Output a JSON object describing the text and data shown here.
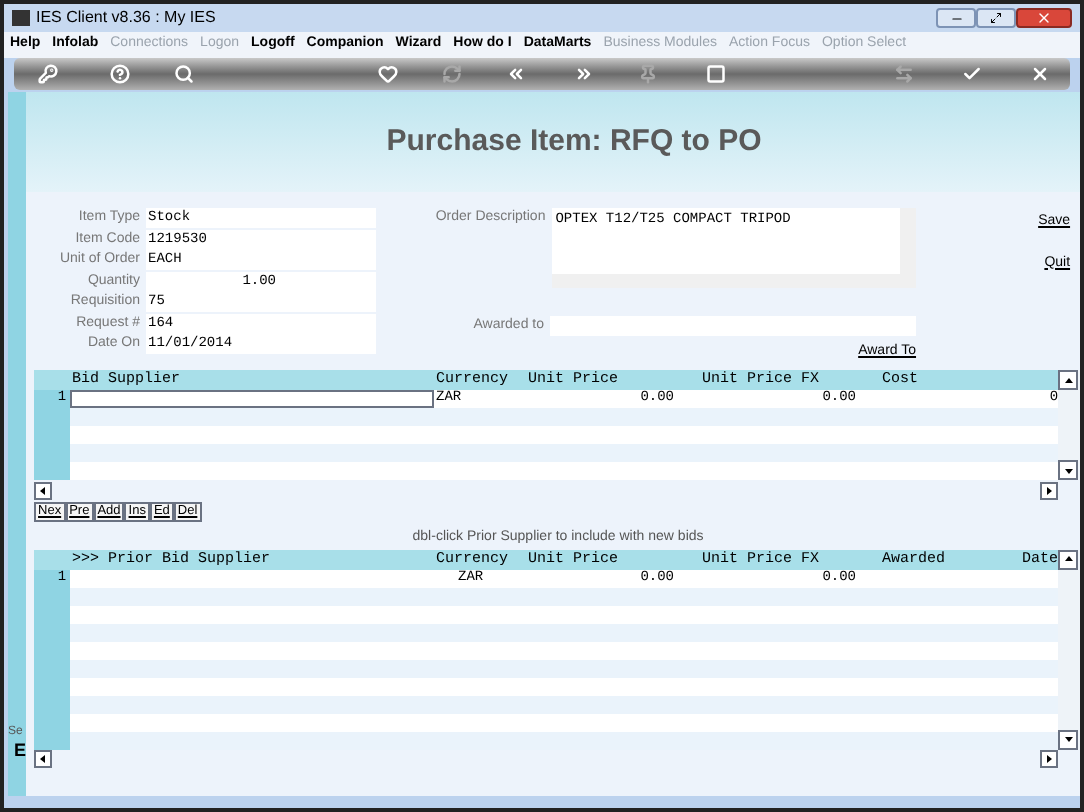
{
  "window": {
    "title": "IES Client v8.36 : My IES"
  },
  "menu": [
    {
      "label": "Help",
      "disabled": false
    },
    {
      "label": "Infolab",
      "disabled": false
    },
    {
      "label": "Connections",
      "disabled": true
    },
    {
      "label": "Logon",
      "disabled": true
    },
    {
      "label": "Logoff",
      "disabled": false
    },
    {
      "label": "Companion",
      "disabled": false
    },
    {
      "label": "Wizard",
      "disabled": false
    },
    {
      "label": "How do I",
      "disabled": false
    },
    {
      "label": "DataMarts",
      "disabled": false
    },
    {
      "label": "Business Modules",
      "disabled": true
    },
    {
      "label": "Action Focus",
      "disabled": true
    },
    {
      "label": "Option Select",
      "disabled": true
    }
  ],
  "toolbar": [
    {
      "disabled": false
    },
    {
      "disabled": false
    },
    {
      "disabled": false
    },
    {
      "disabled": false
    },
    {
      "disabled": true
    },
    {
      "disabled": false
    },
    {
      "disabled": false
    },
    {
      "disabled": true
    },
    {
      "disabled": false
    },
    {
      "disabled": true
    },
    {
      "disabled": false
    },
    {
      "disabled": false
    }
  ],
  "page_title": "Purchase Item: RFQ to PO",
  "fields": [
    {
      "label": "Item Type",
      "value": "Stock",
      "kind": "text"
    },
    {
      "label": "Item Code",
      "value": "1219530",
      "kind": "text"
    },
    {
      "label": "Unit of Order",
      "value": "EACH",
      "kind": "text"
    },
    {
      "label": "Quantity",
      "value": "1.00",
      "kind": "number"
    },
    {
      "label": "Requisition",
      "value": "75",
      "kind": "text"
    },
    {
      "label": "Request #",
      "value": "164",
      "kind": "text"
    },
    {
      "label": "Date On",
      "value": "11/01/2014",
      "kind": "text"
    }
  ],
  "order_description": {
    "label": "Order Description",
    "value": "OPTEX T12/T25 COMPACT TRIPOD"
  },
  "awarded_to": {
    "label": "Awarded to"
  },
  "links": {
    "save": "Save",
    "quit": "Quit",
    "award_to": "Award To"
  },
  "bid_grid": {
    "columns": [
      "Bid Supplier",
      "Currency",
      "Unit Price",
      "Unit Price FX",
      "Cost"
    ],
    "rows": [
      {
        "number": "1",
        "currency": "ZAR",
        "unit_price": "0.00",
        "unit_price_fx": "0.00",
        "last": "0"
      }
    ]
  },
  "nav_buttons": [
    "Nex",
    "Pre",
    "Add",
    "Ins",
    "Ed",
    "Del"
  ],
  "hint": "dbl-click Prior Supplier to include with new bids",
  "prior_grid": {
    "columns": [
      ">>> Prior Bid Supplier",
      "Currency",
      "Unit Price",
      "Unit Price FX",
      "Awarded",
      "Date"
    ],
    "rows": [
      {
        "number": "1",
        "currency": "ZAR",
        "unit_price": "0.00",
        "unit_price_fx": "0.00"
      }
    ]
  },
  "status_fragments": [
    "Se",
    "E"
  ]
}
